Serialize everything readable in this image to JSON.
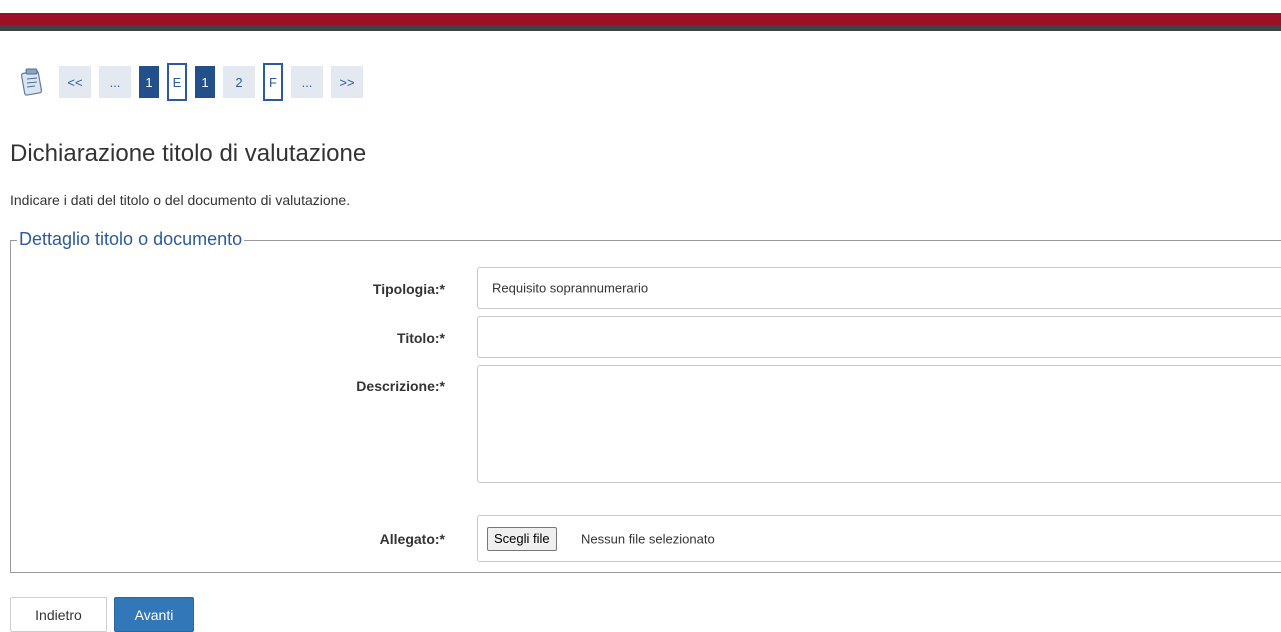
{
  "pager": {
    "items": [
      {
        "label": "<<",
        "style": "light"
      },
      {
        "label": "...",
        "style": "light"
      },
      {
        "label": "1",
        "style": "dark"
      },
      {
        "label": "E",
        "style": "outlined"
      },
      {
        "label": "1",
        "style": "dark"
      },
      {
        "label": "2",
        "style": "light"
      },
      {
        "label": "F",
        "style": "outlined"
      },
      {
        "label": "...",
        "style": "light"
      },
      {
        "label": ">>",
        "style": "light"
      }
    ]
  },
  "page": {
    "title": "Dichiarazione titolo di valutazione",
    "subtitle": "Indicare i dati del titolo o del documento di valutazione."
  },
  "form": {
    "legend": "Dettaglio titolo o documento",
    "tipologia_label": "Tipologia:*",
    "tipologia_value": "Requisito soprannumerario",
    "titolo_label": "Titolo:*",
    "titolo_value": "",
    "descrizione_label": "Descrizione:*",
    "descrizione_value": "",
    "allegato_label": "Allegato:*",
    "file_button": "Scegli file",
    "file_status": "Nessun file selezionato"
  },
  "actions": {
    "back_label": "Indietro",
    "next_label": "Avanti"
  },
  "colors": {
    "brand_red": "#9d0f24",
    "primary_blue": "#3277b8",
    "link_blue": "#2b5b9a"
  }
}
